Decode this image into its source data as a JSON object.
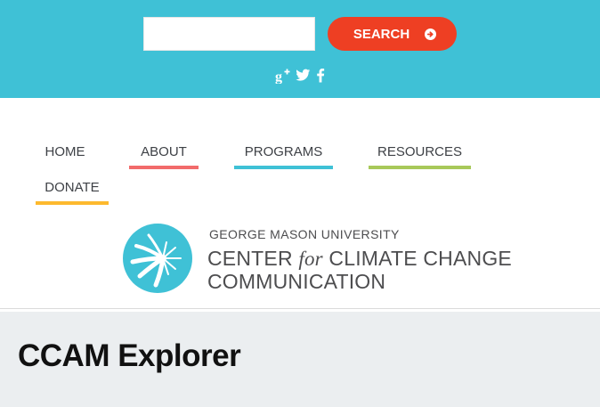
{
  "search": {
    "input_value": "",
    "placeholder": "",
    "button_label": "SEARCH",
    "button_icon": "arrow-right-circle-icon"
  },
  "social": {
    "icons": [
      "google-plus-icon",
      "twitter-icon",
      "facebook-icon"
    ]
  },
  "nav": {
    "items": [
      {
        "label": "HOME",
        "underline_color": ""
      },
      {
        "label": "ABOUT",
        "underline_color": "#f26b6b"
      },
      {
        "label": "PROGRAMS",
        "underline_color": "#3fc1d6"
      },
      {
        "label": "RESOURCES",
        "underline_color": "#a8c95a"
      },
      {
        "label": "DONATE",
        "underline_color": "#fdb92e"
      }
    ]
  },
  "logo": {
    "line1": "GEORGE MASON UNIVERSITY",
    "line2_a": "CENTER ",
    "line2_italic": "for",
    "line2_b": " CLIMATE CHANGE",
    "line3": "COMMUNICATION"
  },
  "page": {
    "title": "CCAM Explorer"
  },
  "colors": {
    "header_bg": "#3fc1d6",
    "search_button": "#ee3f23",
    "title_band_bg": "#ebeef0",
    "logo_teal": "#3fc1d6"
  }
}
